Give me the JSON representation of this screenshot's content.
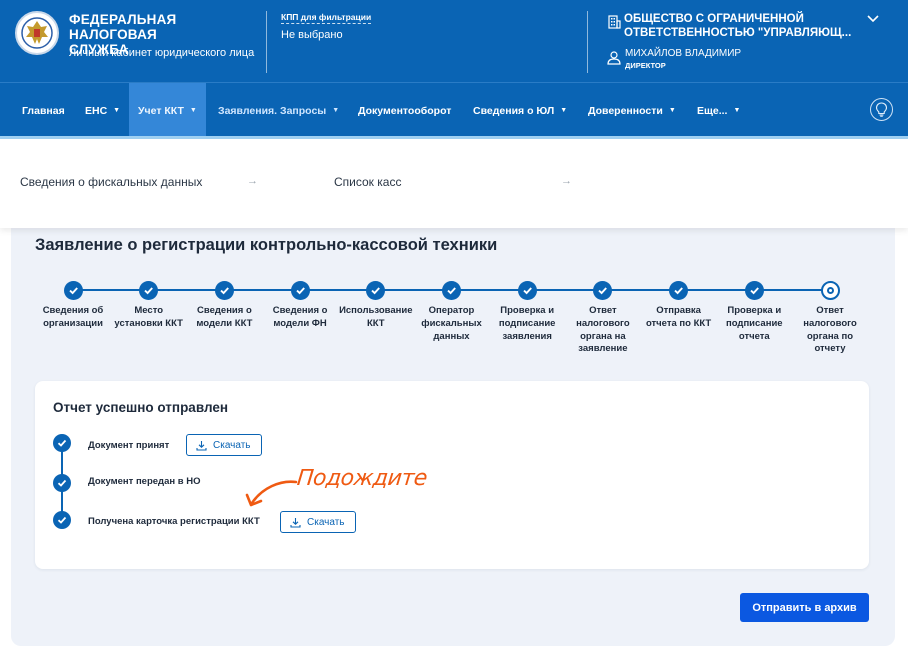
{
  "header": {
    "brand_title": "ФЕДЕРАЛЬНАЯ НАЛОГОВАЯ СЛУЖБА",
    "brand_subtitle": "Личный кабинет юридического лица",
    "kpp_label": "КПП для фильтрации",
    "kpp_value": "Не выбрано",
    "organization_name": "ОБЩЕСТВО С ОГРАНИЧЕННОЙ ОТВЕТСТВЕННОСТЬЮ \"УПРАВЛЯЮЩ...",
    "user_name": "МИХАЙЛОВ ВЛАДИМИР",
    "user_role": "ДИРЕКТОР"
  },
  "nav": {
    "items": [
      {
        "label": "Главная",
        "has_caret": false
      },
      {
        "label": "ЕНС",
        "has_caret": true
      },
      {
        "label": "Учет ККТ",
        "has_caret": true
      },
      {
        "label": "Заявления. Запросы",
        "has_caret": true
      },
      {
        "label": "Документооборот",
        "has_caret": false
      },
      {
        "label": "Сведения о ЮЛ",
        "has_caret": true
      },
      {
        "label": "Доверенности",
        "has_caret": true
      },
      {
        "label": "Еще...",
        "has_caret": true
      }
    ],
    "active_item": "Учет ККТ"
  },
  "submenu": {
    "links": [
      "Сведения о фискальных данных",
      "Список касс"
    ]
  },
  "page": {
    "title": "Заявление о регистрации контрольно-кассовой техники"
  },
  "stepper": {
    "steps": [
      {
        "label": "Сведения об организации",
        "state": "done"
      },
      {
        "label": "Место установки ККТ",
        "state": "done"
      },
      {
        "label": "Сведения о модели ККТ",
        "state": "done"
      },
      {
        "label": "Сведения о модели ФН",
        "state": "done"
      },
      {
        "label": "Использование ККТ",
        "state": "done"
      },
      {
        "label": "Оператор фискальных данных",
        "state": "done"
      },
      {
        "label": "Проверка и подписание заявления",
        "state": "done"
      },
      {
        "label": "Ответ налогового органа на заявление",
        "state": "done"
      },
      {
        "label": "Отправка отчета по ККТ",
        "state": "done"
      },
      {
        "label": "Проверка и подписание отчета",
        "state": "done"
      },
      {
        "label": "Ответ налогового органа по отчету",
        "state": "current"
      }
    ]
  },
  "report": {
    "title": "Отчет успешно отправлен",
    "events": [
      {
        "text": "Документ принят",
        "button": "Скачать"
      },
      {
        "text": "Документ передан в НО"
      },
      {
        "text": "Получена карточка регистрации ККТ",
        "button": "Скачать"
      }
    ],
    "annotation": "Подождите",
    "annotation_color": "#ef5a12"
  },
  "actions": {
    "archive_button": "Отправить в архив"
  },
  "colors": {
    "primary": "#0a64b4",
    "nav_active": "#3487d8",
    "archive_button": "#0b58e1"
  }
}
